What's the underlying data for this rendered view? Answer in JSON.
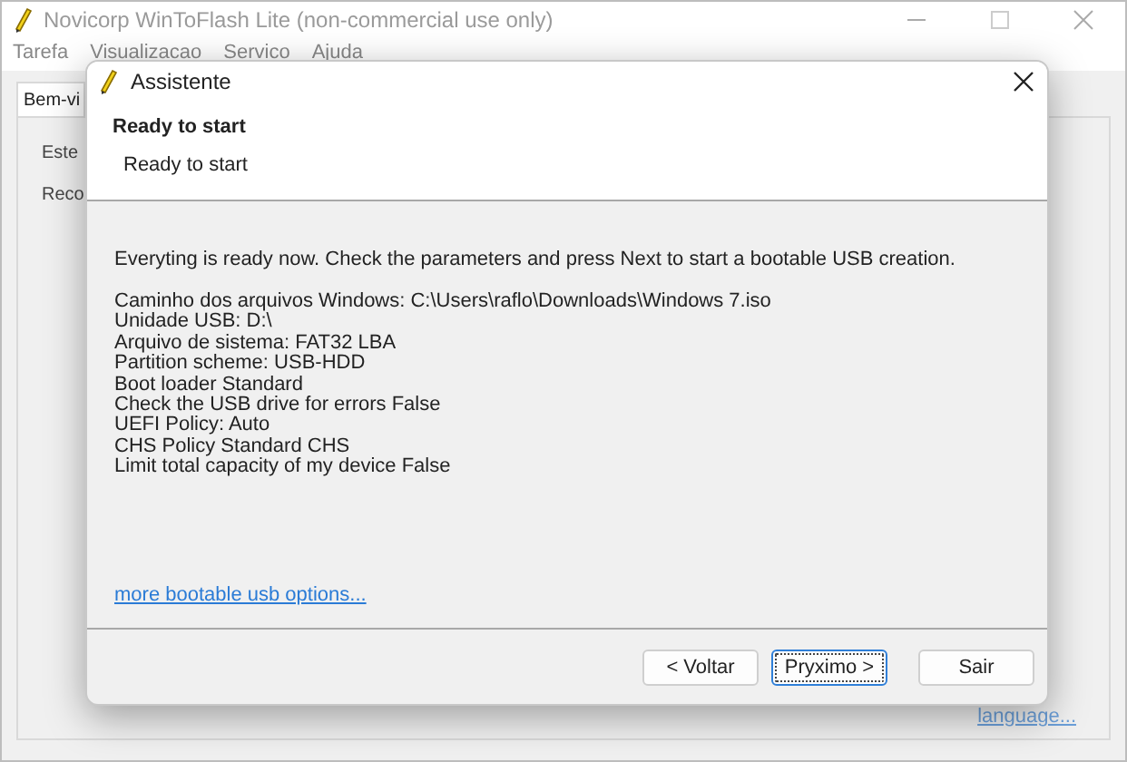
{
  "window": {
    "title": "Novicorp WinToFlash Lite (non-commercial use only)"
  },
  "menu": [
    "Tarefa",
    "Visualizacao",
    "Servico",
    "Ajuda"
  ],
  "tabs": [
    {
      "label": "Bem-vi",
      "selected": true
    }
  ],
  "panel_lines": [
    "Este",
    "Reco"
  ],
  "language_link": "language...",
  "dialog": {
    "title": "Assistente",
    "heading": "Ready to start",
    "subheading": "Ready to start",
    "intro": "Everyting is ready now. Check the parameters and press Next to start a bootable USB creation.",
    "parameters": [
      "Caminho dos arquivos Windows: C:\\Users\\raflo\\Downloads\\Windows 7.iso",
      "Unidade USB: D:\\",
      "Arquivo de sistema: FAT32 LBA",
      "Partition scheme: USB-HDD",
      "Boot loader Standard",
      "Check the USB drive for errors False",
      "UEFI Policy: Auto",
      "CHS Policy Standard CHS",
      "Limit total capacity of my device False"
    ],
    "options_link": "more bootable usb options...",
    "buttons": [
      {
        "label": "< Voltar",
        "focused": false
      },
      {
        "label": "Pryximo >",
        "focused": true
      },
      {
        "label": "Sair",
        "focused": false
      }
    ]
  }
}
